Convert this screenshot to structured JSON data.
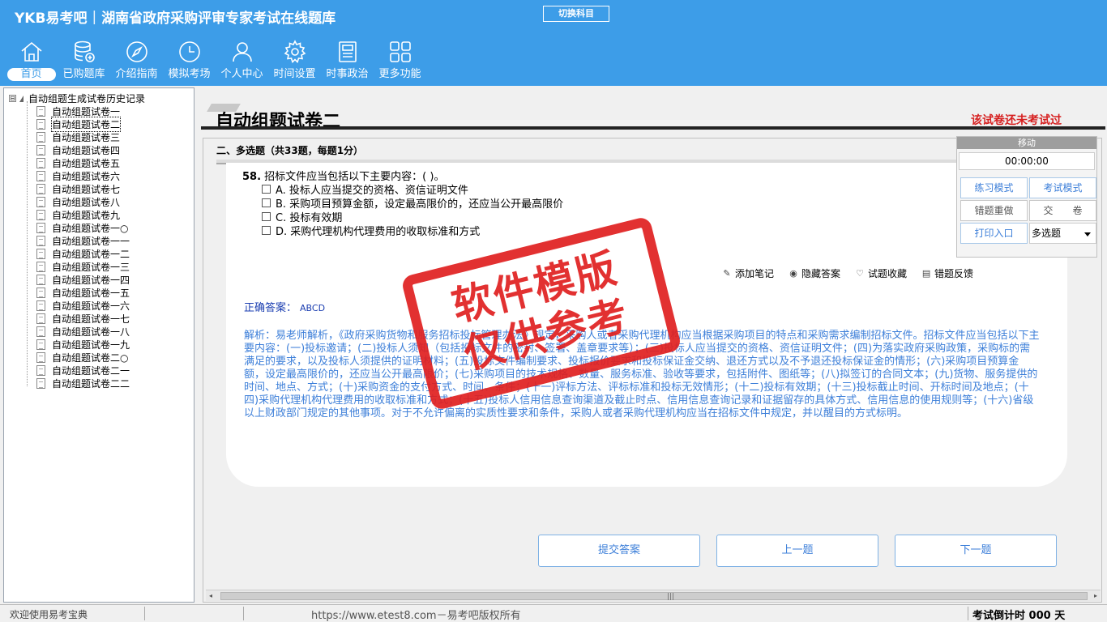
{
  "header": {
    "brand_logo": "YKB易考吧",
    "brand_sep": "|",
    "app_title": "湖南省政府采购评审专家考试在线题库",
    "switch_subject": "切换科目"
  },
  "nav": [
    {
      "label": "首页",
      "icon": "home-icon"
    },
    {
      "label": "已购题库",
      "icon": "database-icon"
    },
    {
      "label": "介绍指南",
      "icon": "compass-icon"
    },
    {
      "label": "模拟考场",
      "icon": "clock-icon"
    },
    {
      "label": "个人中心",
      "icon": "user-icon"
    },
    {
      "label": "时间设置",
      "icon": "gear-icon"
    },
    {
      "label": "时事政治",
      "icon": "news-icon"
    },
    {
      "label": "更多功能",
      "icon": "grid-icon"
    }
  ],
  "tree": {
    "toggle": "⊟",
    "root": "自动组题生成试卷历史记录",
    "items": [
      "自动组题试卷一",
      "自动组题试卷二",
      "自动组题试卷三",
      "自动组题试卷四",
      "自动组题试卷五",
      "自动组题试卷六",
      "自动组题试卷七",
      "自动组题试卷八",
      "自动组题试卷九",
      "自动组题试卷一○",
      "自动组题试卷一一",
      "自动组题试卷一二",
      "自动组题试卷一三",
      "自动组题试卷一四",
      "自动组题试卷一五",
      "自动组题试卷一六",
      "自动组题试卷一七",
      "自动组题试卷一八",
      "自动组题试卷一九",
      "自动组题试卷二○",
      "自动组题试卷二一",
      "自动组题试卷二二"
    ],
    "selected_index": 1
  },
  "main": {
    "title": "自动组题试卷二",
    "status_notice": "该试卷还未考试过",
    "section_heading": "二、多选题（共33题，每题1分）",
    "question": {
      "number": "58.",
      "text": "招标文件应当包括以下主要内容：( )。",
      "options": [
        "A. 投标人应当提交的资格、资信证明文件",
        "B. 采购项目预算金额，设定最高限价的，还应当公开最高限价",
        "C. 投标有效期",
        "D. 采购代理机构代理费用的收取标准和方式"
      ]
    },
    "tools": [
      {
        "label": "添加笔记",
        "icon": "pencil-icon",
        "glyph": "✎"
      },
      {
        "label": "隐藏答案",
        "icon": "eye-icon",
        "glyph": "◉"
      },
      {
        "label": "试题收藏",
        "icon": "heart-icon",
        "glyph": "♡"
      },
      {
        "label": "错题反馈",
        "icon": "feedback-icon",
        "glyph": "▤"
      }
    ],
    "answer_label": "正确答案：",
    "answer_value": "ABCD",
    "analysis": "解析：易老师解析，《政府采购货物和服务招标投标管理办法》规定，采购人或者采购代理机构应当根据采购项目的特点和采购需求编制招标文件。招标文件应当包括以下主要内容：(一)投标邀请；(二)投标人须知（包括投标文件的密封、签署、盖章要求等）；(三)投标人应当提交的资格、资信证明文件；(四)为落实政府采购政策，采购标的需满足的要求，以及投标人须提供的证明材料；(五)投标文件编制要求、投标报价要求和投标保证金交纳、退还方式以及不予退还投标保证金的情形；(六)采购项目预算金额，设定最高限价的，还应当公开最高限价；(七)采购项目的技术规格、数量、服务标准、验收等要求，包括附件、图纸等；(八)拟签订的合同文本；(九)货物、服务提供的时间、地点、方式；(十)采购资金的支付方式、时间、条件；(十一)评标方法、评标标准和投标无效情形；(十二)投标有效期；(十三)投标截止时间、开标时间及地点；(十四)采购代理机构代理费用的收取标准和方式；(十五)投标人信用信息查询渠道及截止时点、信用信息查询记录和证据留存的具体方式、信用信息的使用规则等；(十六)省级以上财政部门规定的其他事项。对于不允许偏离的实质性要求和条件，采购人或者采购代理机构应当在招标文件中规定，并以醒目的方式标明。",
    "buttons": {
      "submit": "提交答案",
      "prev": "上一题",
      "next": "下一题"
    }
  },
  "scrollbar": {
    "left_arrow": "◂",
    "grip": "|||",
    "right_arrow": "▸"
  },
  "timer_panel": {
    "move": "移动",
    "time": "00:00:00",
    "practice_mode": "练习模式",
    "exam_mode": "考试模式",
    "redo_wrong": "错题重做",
    "submit_paper": "交　　卷",
    "print_entry": "打印入口",
    "type_select": "多选题"
  },
  "watermark": {
    "line1": "软件模版",
    "line2": "仅供参考"
  },
  "statusbar": {
    "welcome": "欢迎使用易考宝典",
    "copyright": "https://www.etest8.com－易考吧版权所有",
    "countdown": "考试倒计时 000 天"
  }
}
